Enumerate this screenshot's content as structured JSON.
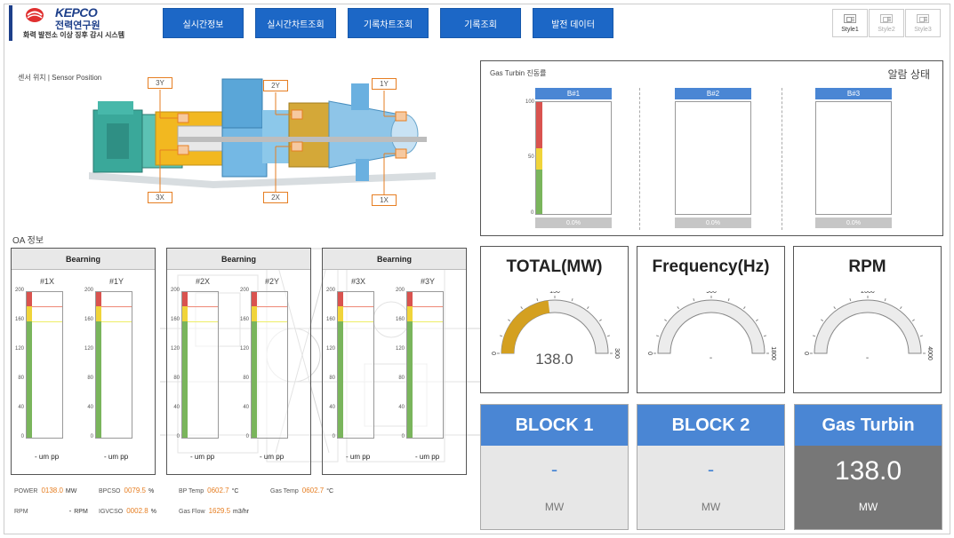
{
  "header": {
    "brand": "KEPCO",
    "brand_ko": "전력연구원",
    "system_title": "화력 발전소 이상 징후 감시 시스템",
    "nav": [
      "실시간정보",
      "실시간차트조회",
      "기록차트조회",
      "기록조회",
      "발전 데이터"
    ],
    "styles": [
      "Style1",
      "Style2",
      "Style3"
    ]
  },
  "sensor": {
    "title": "센서 위치 | Sensor Position",
    "tags": [
      "3Y",
      "2Y",
      "1Y",
      "3X",
      "2X",
      "1X"
    ]
  },
  "oa": {
    "title": "OA 정보",
    "panels": [
      {
        "title": "Bearning",
        "gauges": [
          {
            "label": "#1X",
            "unit": "um pp",
            "value": "-"
          },
          {
            "label": "#1Y",
            "unit": "um pp",
            "value": "-"
          }
        ]
      },
      {
        "title": "Bearning",
        "gauges": [
          {
            "label": "#2X",
            "unit": "um pp",
            "value": "-"
          },
          {
            "label": "#2Y",
            "unit": "um pp",
            "value": "-"
          }
        ]
      },
      {
        "title": "Bearning",
        "gauges": [
          {
            "label": "#3X",
            "unit": "um pp",
            "value": "-"
          },
          {
            "label": "#3Y",
            "unit": "um pp",
            "value": "-"
          }
        ]
      }
    ],
    "yticks": [
      "200",
      "160",
      "120",
      "80",
      "40",
      "0"
    ],
    "bar_colors": {
      "red": "#d9534f",
      "yellow": "#f0d43a",
      "green": "#7ab55c"
    }
  },
  "stats": [
    {
      "label": "POWER",
      "value": "0138.0",
      "unit": "MW"
    },
    {
      "label": "RPM",
      "value": "-",
      "unit": "RPM"
    },
    {
      "label": "BPCSO",
      "value": "0079.5",
      "unit": "%"
    },
    {
      "label": "IGVCSO",
      "value": "0002.8",
      "unit": "%"
    },
    {
      "label": "BP Temp",
      "value": "0602.7",
      "unit": "°C"
    },
    {
      "label": "Gas Flow",
      "value": "1629.5",
      "unit": "m3/hr"
    },
    {
      "label": "Gas Temp",
      "value": "0602.7",
      "unit": "°C"
    }
  ],
  "gas_turbine": {
    "title": "Gas Turbin 진동률",
    "alarm_title": "알람 상태",
    "blocks": [
      {
        "name": "B#1",
        "percent": "0.0%"
      },
      {
        "name": "B#2",
        "percent": "0.0%"
      },
      {
        "name": "B#3",
        "percent": "0.0%"
      }
    ],
    "yticks": [
      "100",
      "50",
      "0"
    ]
  },
  "gauges": [
    {
      "title": "TOTAL(MW)",
      "min": "0",
      "mid": "150",
      "max": "300",
      "value": "138.0",
      "fill": 0.46,
      "color": "#d4a020"
    },
    {
      "title": "Frequency(Hz)",
      "min": "0",
      "mid": "900",
      "max": "1800",
      "value": "-",
      "fill": 0
    },
    {
      "title": "RPM",
      "min": "0",
      "mid": "2000",
      "max": "4000",
      "value": "-",
      "fill": 0
    }
  ],
  "blocks": [
    {
      "title": "BLOCK 1",
      "value": "-",
      "unit": "MW"
    },
    {
      "title": "BLOCK 2",
      "value": "-",
      "unit": "MW"
    },
    {
      "title": "Gas Turbin",
      "value": "138.0",
      "unit": "MW"
    }
  ]
}
